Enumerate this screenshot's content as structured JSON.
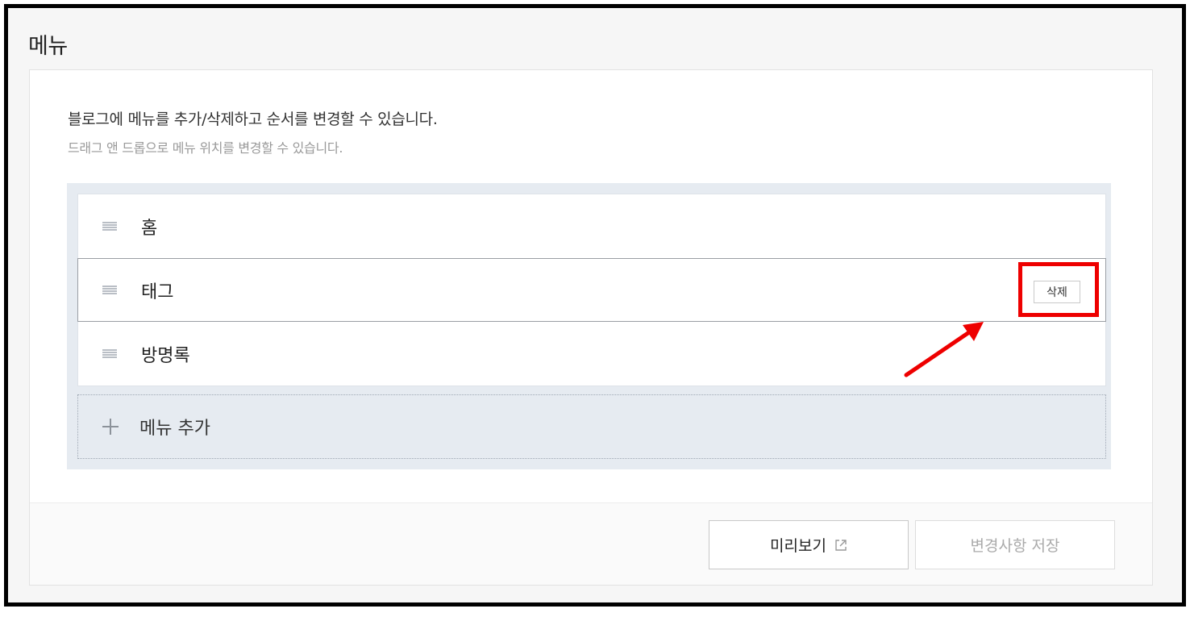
{
  "page": {
    "title": "메뉴",
    "description_primary": "블로그에 메뉴를 추가/삭제하고 순서를 변경할 수 있습니다.",
    "description_secondary": "드래그 앤 드롭으로 메뉴 위치를 변경할 수 있습니다."
  },
  "menu": {
    "items": [
      {
        "label": "홈"
      },
      {
        "label": "태그",
        "selected": true,
        "delete_label": "삭제"
      },
      {
        "label": "방명록"
      }
    ],
    "add_label": "메뉴 추가"
  },
  "footer": {
    "preview_label": "미리보기",
    "save_label": "변경사항 저장"
  },
  "annotation": {
    "color": "#ee0000"
  }
}
